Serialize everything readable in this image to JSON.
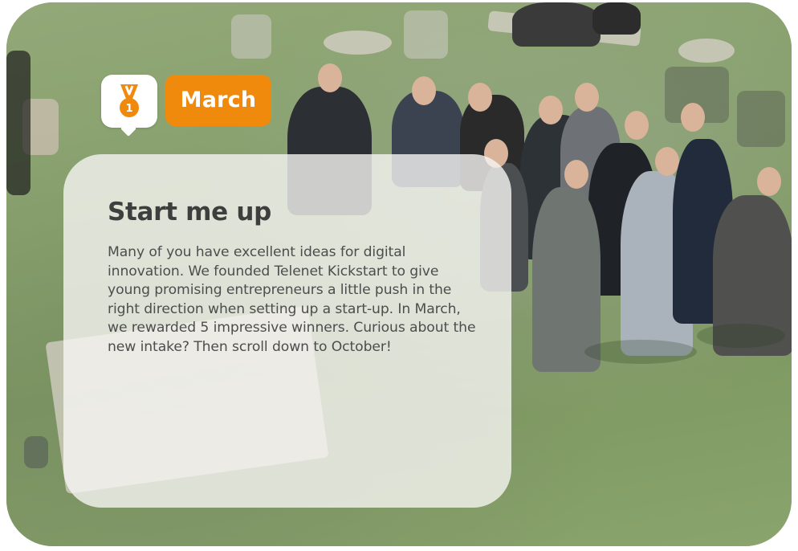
{
  "colors": {
    "accent": "#ef8a0d",
    "card_background": "#f6f5f2",
    "title_text": "#3e3e3e",
    "body_text": "#4d4d4d"
  },
  "badge": {
    "icon": "medal-icon",
    "medal_number": "1"
  },
  "month": {
    "label": "March"
  },
  "card": {
    "title": "Start me up",
    "body": "Many of you have excellent ideas for digital innovation. We founded Telenet Kickstart to give young promising entrepreneurs a little push in the right direction when setting up a start-up. In March, we rewarded 5 impressive winners. Curious about the new intake? Then scroll down to October!"
  }
}
